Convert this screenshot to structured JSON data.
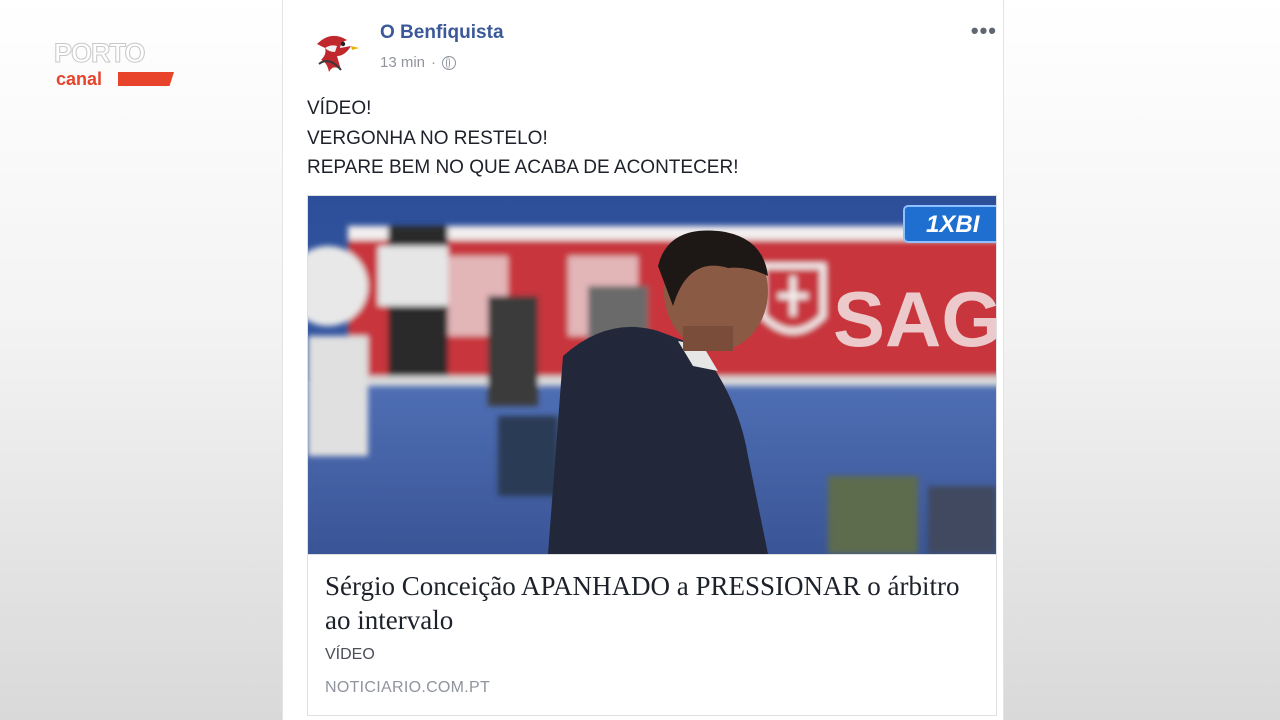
{
  "watermark": {
    "line1": "PORTO",
    "line2": "canal"
  },
  "post": {
    "page_name": "O Benfiquista",
    "time": "13 min",
    "separator": "·",
    "more_icon": "•••",
    "lines": [
      "VÍDEO!",
      "VERGONHA NO RESTELO!",
      "REPARE BEM NO QUE ACABA DE ACONTECER!"
    ]
  },
  "link": {
    "image_banner_text": "SAGI",
    "image_logo_text": "1XBI",
    "title": "Sérgio Conceição APANHADO a PRESSIONAR o árbitro ao intervalo",
    "description": "VÍDEO",
    "domain": "NOTICIARIO.COM.PT"
  },
  "colors": {
    "page_name": "#3b5998",
    "watermark_red": "#e8432b",
    "banner_red": "#c8343c",
    "stand_blue": "#3a5596"
  }
}
